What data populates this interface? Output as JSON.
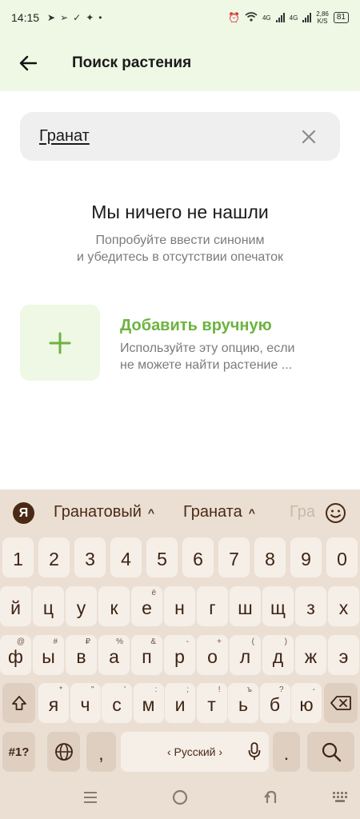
{
  "status_bar": {
    "time": "14:15",
    "network_1": "4G",
    "network_2": "4G",
    "speed_value": "2,86",
    "speed_unit": "K/S",
    "battery": "81"
  },
  "app_bar": {
    "title": "Поиск растения"
  },
  "search": {
    "value": "Гранат"
  },
  "empty_state": {
    "title": "Мы ничего не нашли",
    "subtitle_line1": "Попробуйте ввести синоним",
    "subtitle_line2": "и убедитесь в отсутствии опечаток"
  },
  "add_manual": {
    "icon": "plus-icon",
    "title": "Добавить вручную",
    "desc_line1": "Используйте эту опцию, если",
    "desc_line2": "не можете найти растение ..."
  },
  "keyboard": {
    "logo": "Я",
    "suggestions": [
      "Гранатовый",
      "Граната",
      "Гра"
    ],
    "numbers": [
      "1",
      "2",
      "3",
      "4",
      "5",
      "6",
      "7",
      "8",
      "9",
      "0"
    ],
    "row1": [
      "й",
      "ц",
      "у",
      "к",
      "е",
      "н",
      "г",
      "ш",
      "щ",
      "з",
      "х"
    ],
    "row1_hints": [
      "",
      "",
      "",
      "",
      "ё",
      "",
      "",
      "",
      "",
      "",
      ""
    ],
    "row2": [
      "ф",
      "ы",
      "в",
      "а",
      "п",
      "р",
      "о",
      "л",
      "д",
      "ж",
      "э"
    ],
    "row2_hints": [
      "@",
      "#",
      "₽",
      "%",
      "&",
      "-",
      "+",
      "(",
      ")",
      "",
      ""
    ],
    "row3": [
      "я",
      "ч",
      "с",
      "м",
      "и",
      "т",
      "ь",
      "б",
      "ю"
    ],
    "row3_hints": [
      "*",
      "\"",
      "'",
      ":",
      ";",
      "!",
      "ъ",
      "?",
      "-"
    ],
    "symbols_key": "#1?",
    "comma_key": ",",
    "space_label": "‹ Русский ›",
    "period_key": "."
  }
}
